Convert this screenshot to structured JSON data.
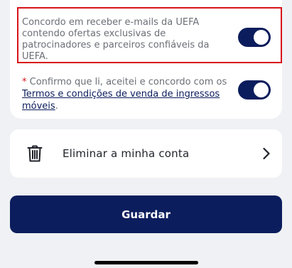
{
  "consents": {
    "marketing": {
      "text": "Concordo em receber e-mails da UEFA contendo ofertas exclusivas de patrocinadores e parceiros confiáveis da UEFA.",
      "enabled": true
    },
    "terms": {
      "asterisk": "*",
      "text_before": " Confirmo que li, aceitei e concordo com os ",
      "link_text": "Termos e condições de venda de ingressos móveis",
      "text_after": ".",
      "enabled": true
    }
  },
  "account": {
    "delete_label": "Eliminar a minha conta",
    "icon": "trash-icon",
    "chevron": "chevron-right-icon"
  },
  "actions": {
    "save_label": "Guardar"
  },
  "colors": {
    "primary": "#0b1d5c",
    "highlight": "#d8141a",
    "background": "#eff1f4"
  }
}
